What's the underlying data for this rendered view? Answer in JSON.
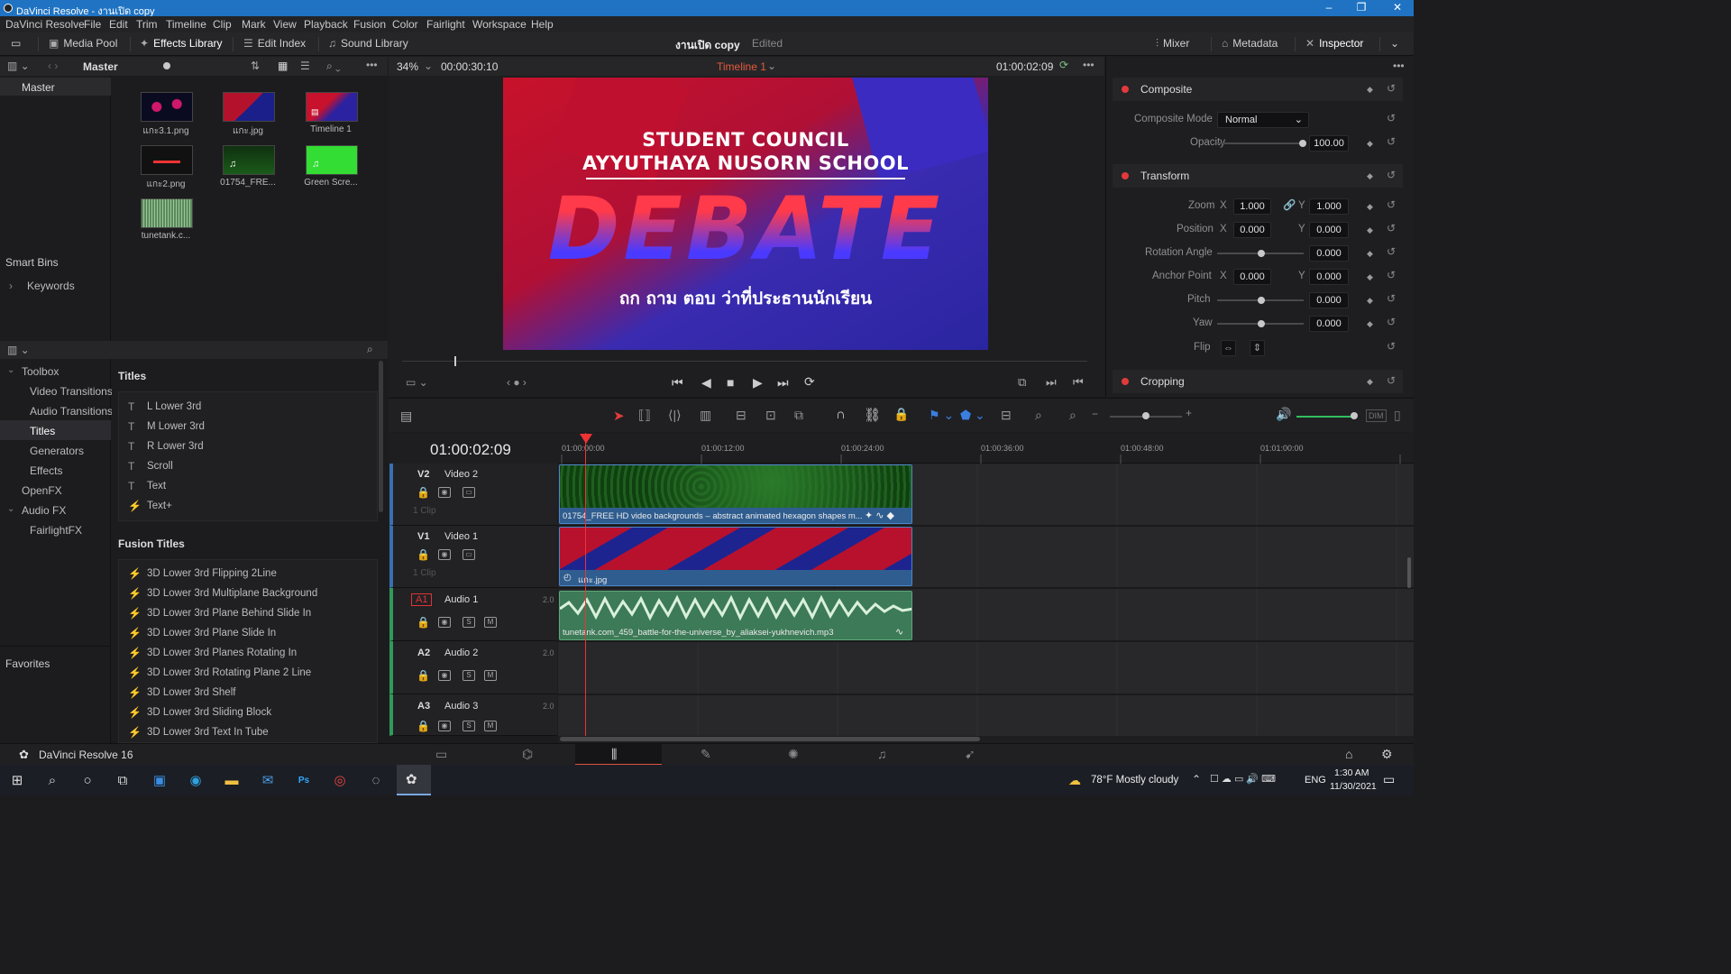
{
  "window": {
    "title": "DaVinci Resolve - งานเปิด copy",
    "controls": [
      "–",
      "❐",
      "✕"
    ]
  },
  "menu": [
    "DaVinci Resolve",
    "File",
    "Edit",
    "Trim",
    "Timeline",
    "Clip",
    "Mark",
    "View",
    "Playback",
    "Fusion",
    "Color",
    "Fairlight",
    "Workspace",
    "Help"
  ],
  "toolbar": {
    "media_pool": "Media Pool",
    "effects_library": "Effects Library",
    "edit_index": "Edit Index",
    "sound_library": "Sound Library",
    "project_name": "งานเปิด copy",
    "project_status": "Edited",
    "mixer": "Mixer",
    "metadata": "Metadata",
    "inspector": "Inspector"
  },
  "media_pool": {
    "bin": "Master",
    "master_label": "Master",
    "smart_bins": "Smart Bins",
    "keywords": "Keywords",
    "clips": [
      {
        "name": "แกะ3.1.png"
      },
      {
        "name": "แกะ.jpg"
      },
      {
        "name": "Timeline 1"
      },
      {
        "name": "แกะ2.png"
      },
      {
        "name": "01754_FRE..."
      },
      {
        "name": "Green Scre..."
      },
      {
        "name": "tunetank.c..."
      }
    ]
  },
  "effects": {
    "tree": [
      "Toolbox",
      "Video Transitions",
      "Audio Transitions",
      "Titles",
      "Generators",
      "Effects",
      "OpenFX",
      "Audio FX",
      "FairlightFX"
    ],
    "favorites": "Favorites",
    "titles_header": "Titles",
    "titles": [
      "L Lower 3rd",
      "M Lower 3rd",
      "R Lower 3rd",
      "Scroll",
      "Text",
      "Text+"
    ],
    "fusion_header": "Fusion Titles",
    "fusion_titles": [
      "3D Lower 3rd Flipping 2Line",
      "3D Lower 3rd Multiplane Background",
      "3D Lower 3rd Plane Behind Slide In",
      "3D Lower 3rd Plane Slide In",
      "3D Lower 3rd Planes Rotating In",
      "3D Lower 3rd Rotating Plane 2 Line",
      "3D Lower 3rd Shelf",
      "3D Lower 3rd Sliding Block",
      "3D Lower 3rd Text In Tube"
    ]
  },
  "viewer": {
    "zoom": "34%",
    "duration": "00:00:30:10",
    "timeline_name": "Timeline 1",
    "timecode": "01:00:02:09",
    "frame": {
      "line1": "STUDENT COUNCIL",
      "line2": "AYYUTHAYA NUSORN SCHOOL",
      "big": "DEBATE",
      "thai": "ถก ถาม ตอบ ว่าที่ประธานนักเรียน"
    }
  },
  "inspector": {
    "composite": "Composite",
    "composite_mode_label": "Composite Mode",
    "composite_mode": "Normal",
    "opacity_label": "Opacity",
    "opacity": "100.00",
    "transform": "Transform",
    "zoom_label": "Zoom",
    "zoom_x": "1.000",
    "zoom_y": "1.000",
    "position_label": "Position",
    "pos_x": "0.000",
    "pos_y": "0.000",
    "rotation_label": "Rotation Angle",
    "rotation": "0.000",
    "anchor_label": "Anchor Point",
    "anchor_x": "0.000",
    "anchor_y": "0.000",
    "pitch_label": "Pitch",
    "pitch": "0.000",
    "yaw_label": "Yaw",
    "yaw": "0.000",
    "flip_label": "Flip",
    "cropping": "Cropping",
    "x": "X",
    "y": "Y"
  },
  "timeline": {
    "timecode": "01:00:02:09",
    "ruler": [
      "01:00:00:00",
      "01:00:12:00",
      "01:00:24:00",
      "01:00:36:00",
      "01:00:48:00",
      "01:01:00:00"
    ],
    "tracks": [
      {
        "id": "V2",
        "name": "Video 2",
        "clips": "1 Clip"
      },
      {
        "id": "V1",
        "name": "Video 1",
        "clips": "1 Clip"
      },
      {
        "id": "A1",
        "name": "Audio 1",
        "ch": "2.0"
      },
      {
        "id": "A2",
        "name": "Audio 2",
        "ch": "2.0"
      },
      {
        "id": "A3",
        "name": "Audio 3",
        "ch": "2.0"
      }
    ],
    "v2_clip": "01754_FREE HD video backgrounds – abstract animated hexagon shapes m...",
    "v1_clip": "แกะ.jpg",
    "a1_clip": "tunetank.com_459_battle-for-the-universe_by_aliaksei-yukhnevich.mp3",
    "solo": "S",
    "mute": "M",
    "dim": "DIM"
  },
  "footer": {
    "app": "DaVinci Resolve 16"
  },
  "taskbar": {
    "weather": "78°F  Mostly cloudy",
    "lang": "ENG",
    "time": "1:30 AM",
    "date": "11/30/2021"
  },
  "colors": {
    "accent_red": "#e23a3a",
    "v_clip": "#2f5d8f",
    "a_clip": "#3d7a57",
    "titlebar": "#1f73c2"
  }
}
